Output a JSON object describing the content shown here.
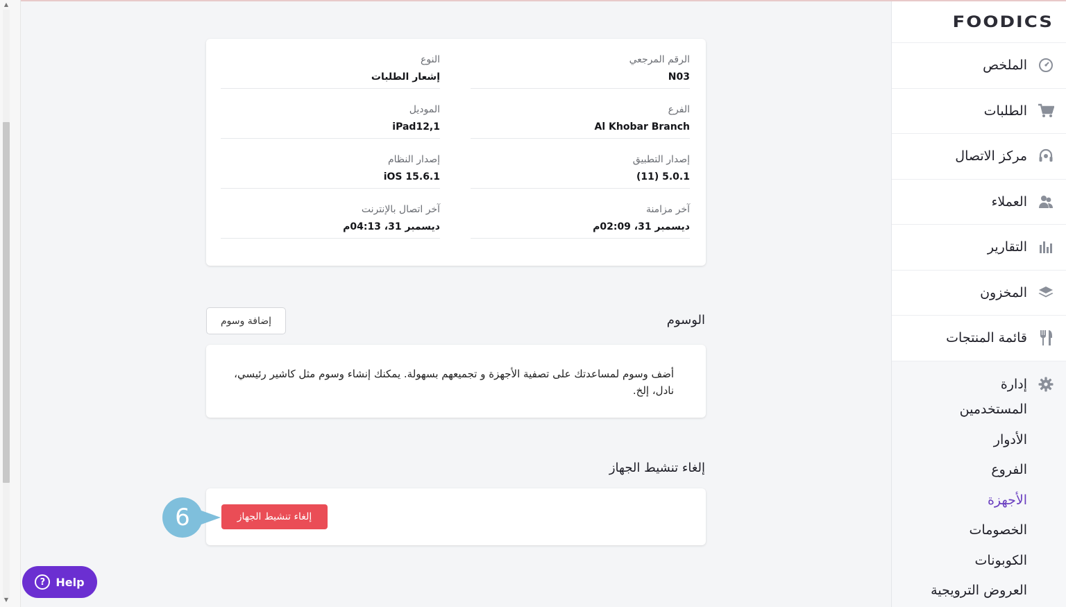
{
  "brand": {
    "logo": "FOODICS",
    "accent": "#6a3fc0",
    "danger": "#ea4d56"
  },
  "sidebar": {
    "items": [
      {
        "label": "الملخص",
        "icon": "dashboard-gauge-icon"
      },
      {
        "label": "الطلبات",
        "icon": "cart-icon"
      },
      {
        "label": "مركز الاتصال",
        "icon": "headset-icon"
      },
      {
        "label": "العملاء",
        "icon": "customers-icon"
      },
      {
        "label": "التقارير",
        "icon": "bar-chart-icon"
      },
      {
        "label": "المخزون",
        "icon": "layers-icon"
      },
      {
        "label": "قائمة المنتجات",
        "icon": "fork-knife-icon"
      }
    ],
    "admin": {
      "label": "إدارة",
      "icon": "gear-icon",
      "items": [
        {
          "label": "المستخدمين"
        },
        {
          "label": "الأدوار"
        },
        {
          "label": "الفروع"
        },
        {
          "label": "الأجهزة",
          "active": true
        },
        {
          "label": "الخصومات"
        },
        {
          "label": "الكوبونات"
        },
        {
          "label": "العروض الترويجية"
        }
      ]
    }
  },
  "device_info": {
    "reference_label": "الرقم المرجعي",
    "reference_value": "N03",
    "type_label": "النوع",
    "type_value": "إشعار الطلبات",
    "branch_label": "الفرع",
    "branch_value": "Al Khobar Branch",
    "model_label": "الموديل",
    "model_value": "iPad12,1",
    "app_version_label": "إصدار التطبيق",
    "app_version_value": "5.0.1 (11)",
    "os_version_label": "إصدار النظام",
    "os_version_value": "iOS 15.6.1",
    "last_sync_label": "آخر مزامنة",
    "last_sync_value": "ديسمبر 31، 02:09م",
    "last_online_label": "آخر اتصال بالإنترنت",
    "last_online_value": "ديسمبر 31، 04:13م"
  },
  "tags": {
    "title": "الوسوم",
    "add_button": "إضافة وسوم",
    "empty_text": "أضف وسوم لمساعدتك على تصفية الأجهزة و تجميعهم بسهولة. يمكنك إنشاء وسوم مثل كاشير رئيسي، نادل، إلخ."
  },
  "deactivate": {
    "title": "إلغاء تنشيط الجهاز",
    "button": "إلغاء تنشيط الجهاز"
  },
  "step_marker": {
    "number": "6",
    "color": "#7fbfdc"
  },
  "help": {
    "label": "Help"
  }
}
